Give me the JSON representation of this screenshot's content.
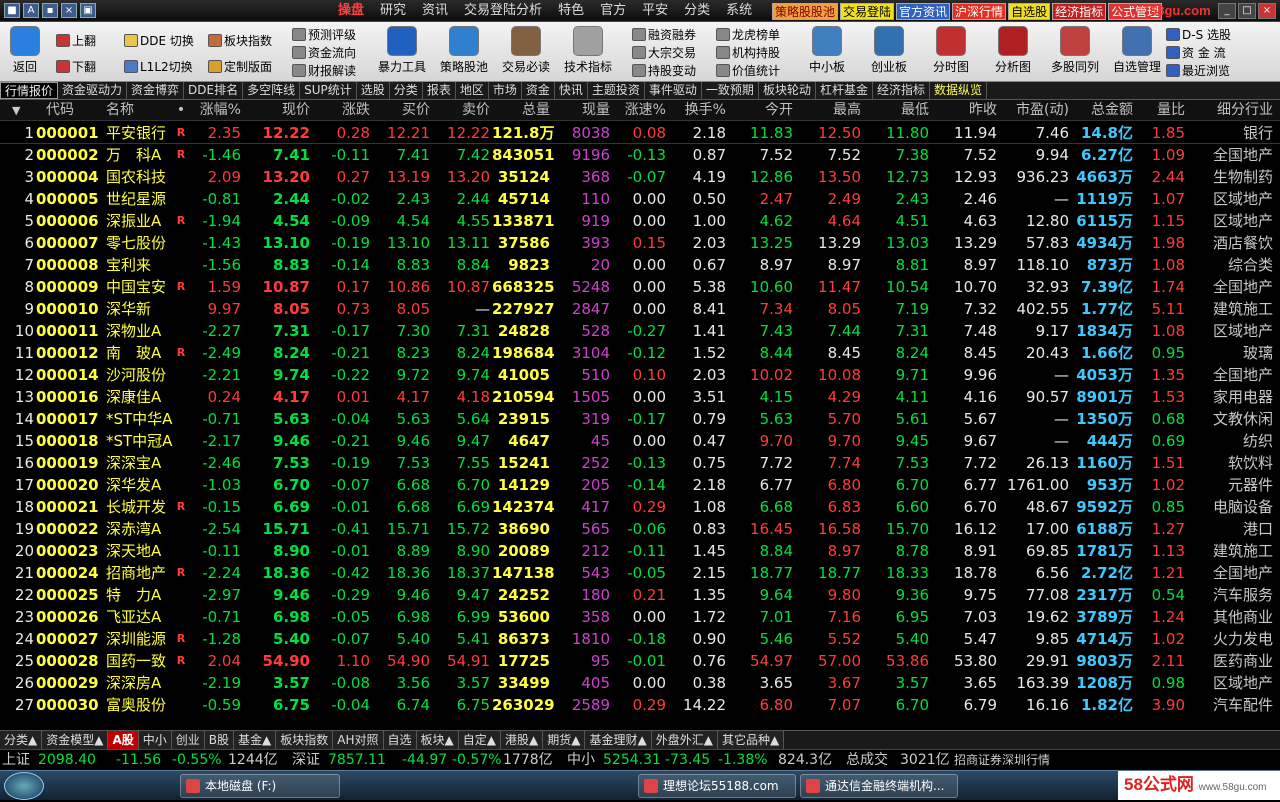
{
  "app": {
    "sys_buttons": [
      "■",
      "A",
      "▪",
      "×",
      "▣"
    ],
    "logo_text": "58gu.com",
    "window_controls": [
      "_",
      "□",
      "×"
    ]
  },
  "menu": [
    "操盘",
    "研究",
    "资讯",
    "交易登陆分析",
    "特色",
    "官方",
    "平安",
    "分类",
    "系统"
  ],
  "quick_links": [
    {
      "label": "策略股股池",
      "bg": "#f0a040",
      "fg": "#800000"
    },
    {
      "label": "交易登陆",
      "bg": "#f0e020",
      "fg": "#000"
    },
    {
      "label": "官方资讯",
      "bg": "#3060c0",
      "fg": "#fff"
    },
    {
      "label": "沪深行情",
      "bg": "#e03020",
      "fg": "#fff"
    },
    {
      "label": "自选股",
      "bg": "#f0e020",
      "fg": "#000"
    },
    {
      "label": "经济指标",
      "bg": "#c02020",
      "fg": "#fff"
    },
    {
      "label": "公式管理",
      "bg": "#e03030",
      "fg": "#fff"
    }
  ],
  "toolbar": {
    "back": "返回",
    "page_up": "上翻",
    "page_down": "下翻",
    "dde_switch": "DDE 切换",
    "l1l2_switch": "L1L2切换",
    "sector_index": "板块指数",
    "custom_page": "定制版面",
    "forecast_rating": "预测评级",
    "capital_flow": "资金流向",
    "financial_interp": "财报解读",
    "big_tools": [
      {
        "name": "violent-tools",
        "label": "暴力工具",
        "color": "#2060c0"
      },
      {
        "name": "strategy-pool",
        "label": "策略股池",
        "color": "#3080d0"
      },
      {
        "name": "trade-must-read",
        "label": "交易必读",
        "color": "#806040"
      },
      {
        "name": "tech-indicators",
        "label": "技术指标",
        "color": "#a0a0a0"
      }
    ],
    "margin_trading": "融资融券",
    "block_trade": "大宗交易",
    "holdings_change": "持股变动",
    "dragon_tiger": "龙虎榜单",
    "institution_holdings": "机构持股",
    "value_stats": "价值统计",
    "big_tools2": [
      {
        "name": "sme-board",
        "label": "中小板",
        "color": "#4080c0"
      },
      {
        "name": "chinext",
        "label": "创业板",
        "color": "#3070b0"
      },
      {
        "name": "time-chart",
        "label": "分时图",
        "color": "#c03030"
      },
      {
        "name": "analysis-chart",
        "label": "分析图",
        "color": "#b02020"
      },
      {
        "name": "multi-stock",
        "label": "多股同列",
        "color": "#c04040"
      },
      {
        "name": "watchlist-mgmt",
        "label": "自选管理",
        "color": "#4070b0"
      }
    ],
    "ds_select": "D-S 选股",
    "capital_stream": "资 金 流",
    "recent_browse": "最近浏览"
  },
  "tabs": [
    {
      "label": "行情报价",
      "active": true
    },
    {
      "label": "资金驱动力"
    },
    {
      "label": "资金博弈"
    },
    {
      "label": "DDE排名"
    },
    {
      "label": "多空阵线"
    },
    {
      "label": "SUP统计"
    },
    {
      "label": "选股"
    },
    {
      "label": "分类"
    },
    {
      "label": "报表"
    },
    {
      "label": "地区"
    },
    {
      "label": "市场"
    },
    {
      "label": "资金"
    },
    {
      "label": "快讯"
    },
    {
      "label": "主题投资"
    },
    {
      "label": "事件驱动"
    },
    {
      "label": "一致预期"
    },
    {
      "label": "板块轮动"
    },
    {
      "label": "杠杆基金"
    },
    {
      "label": "经济指标"
    },
    {
      "label": "数据纵览",
      "highlight": true
    }
  ],
  "columns": [
    "代码",
    "名称",
    "•",
    "涨幅%",
    "现价",
    "涨跌",
    "买价",
    "卖价",
    "总量",
    "现量",
    "涨速%",
    "换手%",
    "今开",
    "最高",
    "最低",
    "昨收",
    "市盈(动)",
    "总金额",
    "量比",
    "细分行业"
  ],
  "sort_button": "▼",
  "rows": [
    [
      "1",
      "000001",
      "平安银行",
      "R",
      "2.35",
      "12.22",
      "0.28",
      "12.21",
      "12.22",
      "121.8万",
      "8038",
      "0.08",
      "2.18",
      "11.83",
      "12.50",
      "11.80",
      "11.94",
      "7.46",
      "14.8亿",
      "1.85",
      "银行"
    ],
    [
      "2",
      "000002",
      "万　科A",
      "R",
      "-1.46",
      "7.41",
      "-0.11",
      "7.41",
      "7.42",
      "843051",
      "9196",
      "-0.13",
      "0.87",
      "7.52",
      "7.52",
      "7.38",
      "7.52",
      "9.94",
      "6.27亿",
      "1.09",
      "全国地产"
    ],
    [
      "3",
      "000004",
      "国农科技",
      "",
      "2.09",
      "13.20",
      "0.27",
      "13.19",
      "13.20",
      "35124",
      "368",
      "-0.07",
      "4.19",
      "12.86",
      "13.50",
      "12.73",
      "12.93",
      "936.23",
      "4663万",
      "2.44",
      "生物制药"
    ],
    [
      "4",
      "000005",
      "世纪星源",
      "",
      "-0.81",
      "2.44",
      "-0.02",
      "2.43",
      "2.44",
      "45714",
      "110",
      "0.00",
      "0.50",
      "2.47",
      "2.49",
      "2.43",
      "2.46",
      "—",
      "1119万",
      "1.07",
      "区域地产"
    ],
    [
      "5",
      "000006",
      "深振业A",
      "R",
      "-1.94",
      "4.54",
      "-0.09",
      "4.54",
      "4.55",
      "133871",
      "919",
      "0.00",
      "1.00",
      "4.62",
      "4.64",
      "4.51",
      "4.63",
      "12.80",
      "6115万",
      "1.15",
      "区域地产"
    ],
    [
      "6",
      "000007",
      "零七股份",
      "",
      "-1.43",
      "13.10",
      "-0.19",
      "13.10",
      "13.11",
      "37586",
      "393",
      "0.15",
      "2.03",
      "13.25",
      "13.29",
      "13.03",
      "13.29",
      "57.83",
      "4934万",
      "1.98",
      "酒店餐饮"
    ],
    [
      "7",
      "000008",
      "宝利来",
      "",
      "-1.56",
      "8.83",
      "-0.14",
      "8.83",
      "8.84",
      "9823",
      "20",
      "0.00",
      "0.67",
      "8.97",
      "8.97",
      "8.81",
      "8.97",
      "118.10",
      "873万",
      "1.08",
      "综合类"
    ],
    [
      "8",
      "000009",
      "中国宝安",
      "R",
      "1.59",
      "10.87",
      "0.17",
      "10.86",
      "10.87",
      "668325",
      "5248",
      "0.00",
      "5.38",
      "10.60",
      "11.47",
      "10.54",
      "10.70",
      "32.93",
      "7.39亿",
      "1.74",
      "全国地产"
    ],
    [
      "9",
      "000010",
      "深华新",
      "",
      "9.97",
      "8.05",
      "0.73",
      "8.05",
      "—",
      "227927",
      "2847",
      "0.00",
      "8.41",
      "7.34",
      "8.05",
      "7.19",
      "7.32",
      "402.55",
      "1.77亿",
      "5.11",
      "建筑施工"
    ],
    [
      "10",
      "000011",
      "深物业A",
      "",
      "-2.27",
      "7.31",
      "-0.17",
      "7.30",
      "7.31",
      "24828",
      "528",
      "-0.27",
      "1.41",
      "7.43",
      "7.44",
      "7.31",
      "7.48",
      "9.17",
      "1834万",
      "1.08",
      "区域地产"
    ],
    [
      "11",
      "000012",
      "南　玻A",
      "R",
      "-2.49",
      "8.24",
      "-0.21",
      "8.23",
      "8.24",
      "198684",
      "3104",
      "-0.12",
      "1.52",
      "8.44",
      "8.45",
      "8.24",
      "8.45",
      "20.43",
      "1.66亿",
      "0.95",
      "玻璃"
    ],
    [
      "12",
      "000014",
      "沙河股份",
      "",
      "-2.21",
      "9.74",
      "-0.22",
      "9.72",
      "9.74",
      "41005",
      "510",
      "0.10",
      "2.03",
      "10.02",
      "10.08",
      "9.71",
      "9.96",
      "—",
      "4053万",
      "1.35",
      "全国地产"
    ],
    [
      "13",
      "000016",
      "深康佳A",
      "",
      "0.24",
      "4.17",
      "0.01",
      "4.17",
      "4.18",
      "210594",
      "1505",
      "0.00",
      "3.51",
      "4.15",
      "4.29",
      "4.11",
      "4.16",
      "90.57",
      "8901万",
      "1.53",
      "家用电器"
    ],
    [
      "14",
      "000017",
      "*ST中华A",
      "",
      "-0.71",
      "5.63",
      "-0.04",
      "5.63",
      "5.64",
      "23915",
      "319",
      "-0.17",
      "0.79",
      "5.63",
      "5.70",
      "5.61",
      "5.67",
      "—",
      "1350万",
      "0.68",
      "文教休闲"
    ],
    [
      "15",
      "000018",
      "*ST中冠A",
      "",
      "-2.17",
      "9.46",
      "-0.21",
      "9.46",
      "9.47",
      "4647",
      "45",
      "0.00",
      "0.47",
      "9.70",
      "9.70",
      "9.45",
      "9.67",
      "—",
      "444万",
      "0.69",
      "纺织"
    ],
    [
      "16",
      "000019",
      "深深宝A",
      "",
      "-2.46",
      "7.53",
      "-0.19",
      "7.53",
      "7.55",
      "15241",
      "252",
      "-0.13",
      "0.75",
      "7.72",
      "7.74",
      "7.53",
      "7.72",
      "26.13",
      "1160万",
      "1.51",
      "软饮料"
    ],
    [
      "17",
      "000020",
      "深华发A",
      "",
      "-1.03",
      "6.70",
      "-0.07",
      "6.68",
      "6.70",
      "14129",
      "205",
      "-0.14",
      "2.18",
      "6.77",
      "6.80",
      "6.70",
      "6.77",
      "1761.00",
      "953万",
      "1.02",
      "元器件"
    ],
    [
      "18",
      "000021",
      "长城开发",
      "R",
      "-0.15",
      "6.69",
      "-0.01",
      "6.68",
      "6.69",
      "142374",
      "417",
      "0.29",
      "1.08",
      "6.68",
      "6.83",
      "6.60",
      "6.70",
      "48.67",
      "9592万",
      "0.85",
      "电脑设备"
    ],
    [
      "19",
      "000022",
      "深赤湾A",
      "",
      "-2.54",
      "15.71",
      "-0.41",
      "15.71",
      "15.72",
      "38690",
      "565",
      "-0.06",
      "0.83",
      "16.45",
      "16.58",
      "15.70",
      "16.12",
      "17.00",
      "6188万",
      "1.27",
      "港口"
    ],
    [
      "20",
      "000023",
      "深天地A",
      "",
      "-0.11",
      "8.90",
      "-0.01",
      "8.89",
      "8.90",
      "20089",
      "212",
      "-0.11",
      "1.45",
      "8.84",
      "8.97",
      "8.78",
      "8.91",
      "69.85",
      "1781万",
      "1.13",
      "建筑施工"
    ],
    [
      "21",
      "000024",
      "招商地产",
      "R",
      "-2.24",
      "18.36",
      "-0.42",
      "18.36",
      "18.37",
      "147138",
      "543",
      "-0.05",
      "2.15",
      "18.77",
      "18.77",
      "18.33",
      "18.78",
      "6.56",
      "2.72亿",
      "1.21",
      "全国地产"
    ],
    [
      "22",
      "000025",
      "特　力A",
      "",
      "-2.97",
      "9.46",
      "-0.29",
      "9.46",
      "9.47",
      "24252",
      "180",
      "0.21",
      "1.35",
      "9.64",
      "9.80",
      "9.36",
      "9.75",
      "77.08",
      "2317万",
      "0.54",
      "汽车服务"
    ],
    [
      "23",
      "000026",
      "飞亚达A",
      "",
      "-0.71",
      "6.98",
      "-0.05",
      "6.98",
      "6.99",
      "53600",
      "358",
      "0.00",
      "1.72",
      "7.01",
      "7.16",
      "6.95",
      "7.03",
      "19.62",
      "3789万",
      "1.24",
      "其他商业"
    ],
    [
      "24",
      "000027",
      "深圳能源",
      "R",
      "-1.28",
      "5.40",
      "-0.07",
      "5.40",
      "5.41",
      "86373",
      "1810",
      "-0.18",
      "0.90",
      "5.46",
      "5.52",
      "5.40",
      "5.47",
      "9.85",
      "4714万",
      "1.02",
      "火力发电"
    ],
    [
      "25",
      "000028",
      "国药一致",
      "R",
      "2.04",
      "54.90",
      "1.10",
      "54.90",
      "54.91",
      "17725",
      "95",
      "-0.01",
      "0.76",
      "54.97",
      "57.00",
      "53.86",
      "53.80",
      "29.91",
      "9803万",
      "2.11",
      "医药商业"
    ],
    [
      "26",
      "000029",
      "深深房A",
      "",
      "-2.19",
      "3.57",
      "-0.08",
      "3.56",
      "3.57",
      "33499",
      "405",
      "0.00",
      "0.38",
      "3.65",
      "3.67",
      "3.57",
      "3.65",
      "163.39",
      "1208万",
      "0.98",
      "区域地产"
    ],
    [
      "27",
      "000030",
      "富奥股份",
      "",
      "-0.59",
      "6.75",
      "-0.04",
      "6.74",
      "6.75",
      "263029",
      "2589",
      "0.29",
      "14.22",
      "6.80",
      "7.07",
      "6.70",
      "6.79",
      "16.16",
      "1.82亿",
      "3.90",
      "汽车配件"
    ]
  ],
  "sheet_tabs": [
    {
      "label": "分类▲"
    },
    {
      "label": "资金模型▲"
    },
    {
      "label": "A股",
      "active": true
    },
    {
      "label": "中小"
    },
    {
      "label": "创业"
    },
    {
      "label": "B股"
    },
    {
      "label": "基金▲"
    },
    {
      "label": "板块指数"
    },
    {
      "label": "AH对照"
    },
    {
      "label": "自选"
    },
    {
      "label": "板块▲"
    },
    {
      "label": "自定▲"
    },
    {
      "label": "港股▲"
    },
    {
      "label": "期货▲"
    },
    {
      "label": "基金理财▲"
    },
    {
      "label": "外盘外汇▲"
    },
    {
      "label": "其它品种▲"
    }
  ],
  "index_bar": {
    "sh_label": "上证",
    "sh_value": "2098.40",
    "sh_change": "-11.56",
    "sh_pct": "-0.55%",
    "sh_amount": "1244亿",
    "sz_label": "深证",
    "sz_value": "7857.11",
    "sz_change": "-44.97",
    "sz_pct": "-0.57%",
    "sz_amount": "1778亿",
    "zx_label": "中小",
    "zx_value": "5254.31",
    "zx_change": "-73.45",
    "zx_pct": "-1.38%",
    "zx_amount": "824.3亿",
    "total_label": "总成交",
    "total_amount": "3021亿",
    "broker": "招商证券深圳行情"
  },
  "taskbar": {
    "items": [
      "本地磁盘 (F:)",
      "理想论坛55188.com",
      "通达信金融终端机构..."
    ]
  },
  "watermark": {
    "main": "58公式网",
    "sub": "www.58gu.com"
  },
  "colors": {
    "up": "#ff3b3b",
    "down": "#00e040",
    "flat": "#e8e8e8",
    "code": "#ffff40",
    "name": "#ffff40",
    "volume": "#ffff40",
    "curvol": "#d040d0",
    "amount": "#40c8ff",
    "industry": "#c8c8c8"
  }
}
